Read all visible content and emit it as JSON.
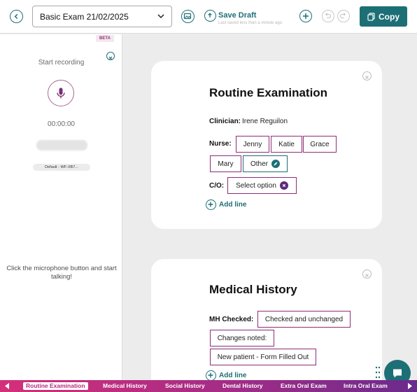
{
  "toolbar": {
    "exam_selected": "Basic Exam 21/02/2025",
    "save_label": "Save Draft",
    "save_subtext": "Last saved less than a minute ago",
    "copy_label": "Copy"
  },
  "left_panel": {
    "beta_label": "BETA",
    "start_label": "Start recording",
    "timer": "00:00:00",
    "device_label": "Default - WF-XB7...",
    "hint": "Click the microphone button and start talking!"
  },
  "routine": {
    "title": "Routine Examination",
    "clinician_label": "Clinician:",
    "clinician_value": "Irene Reguilon",
    "nurse_label": "Nurse:",
    "nurses": [
      "Jenny",
      "Katie",
      "Grace",
      "Mary",
      "Other"
    ],
    "co_label": "C/O:",
    "co_value": "Select option",
    "add_line": "Add line"
  },
  "medical": {
    "title": "Medical History",
    "mh_label": "MH Checked:",
    "mh_value": "Checked and unchanged",
    "changes": "Changes noted:",
    "new_patient": "New patient - Form Filled Out",
    "add_line": "Add line"
  },
  "tabs": [
    "Routine Examination",
    "Medical History",
    "Social History",
    "Dental History",
    "Extra Oral Exam",
    "Intra Oral Exam"
  ],
  "colors": {
    "teal": "#1d6f76",
    "purple": "#8c2e76",
    "tabbar_start": "#d52f79",
    "tabbar_end": "#6a2b8d"
  },
  "icons": [
    "back-icon",
    "chevron-down-icon",
    "image-icon",
    "cloud-upload-icon",
    "plus-icon",
    "undo-icon",
    "redo-icon",
    "copy-icon",
    "close-icon",
    "microphone-icon",
    "pencil-icon",
    "chat-icon"
  ]
}
